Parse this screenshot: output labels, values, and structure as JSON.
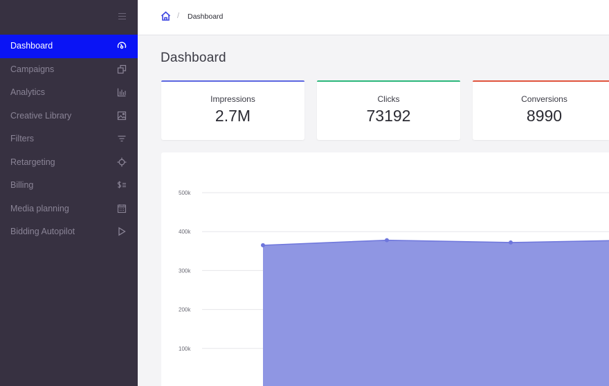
{
  "sidebar": {
    "items": [
      {
        "label": "Dashboard",
        "icon": "gauge-icon",
        "active": true
      },
      {
        "label": "Campaigns",
        "icon": "copy-icon",
        "active": false
      },
      {
        "label": "Analytics",
        "icon": "bar-chart-icon",
        "active": false
      },
      {
        "label": "Creative Library",
        "icon": "image-icon",
        "active": false
      },
      {
        "label": "Filters",
        "icon": "filter-icon",
        "active": false
      },
      {
        "label": "Retargeting",
        "icon": "crosshair-icon",
        "active": false
      },
      {
        "label": "Billing",
        "icon": "dollar-list-icon",
        "active": false
      },
      {
        "label": "Media planning",
        "icon": "calendar-icon",
        "active": false
      },
      {
        "label": "Bidding Autopilot",
        "icon": "play-icon",
        "active": false
      }
    ]
  },
  "breadcrumb": {
    "separator": "/",
    "current": "Dashboard"
  },
  "page": {
    "title": "Dashboard"
  },
  "stats": [
    {
      "title": "Impressions",
      "value": "2.7M",
      "color": "#5b66e0"
    },
    {
      "title": "Clicks",
      "value": "73192",
      "color": "#2ab67a"
    },
    {
      "title": "Conversions",
      "value": "8990",
      "color": "#e0533c"
    }
  ],
  "colors": {
    "sidebar_bg": "#373141",
    "active_bg": "#0a14f5",
    "area_fill": "#8f96e3",
    "area_line": "#6e76dc"
  },
  "chart_data": {
    "type": "area",
    "yticks": [
      "500k",
      "400k",
      "300k",
      "200k",
      "100k"
    ],
    "ylim": [
      0,
      500000
    ],
    "grid": true,
    "series": [
      {
        "values": [
          365000,
          378000,
          372000,
          378000
        ]
      }
    ]
  }
}
